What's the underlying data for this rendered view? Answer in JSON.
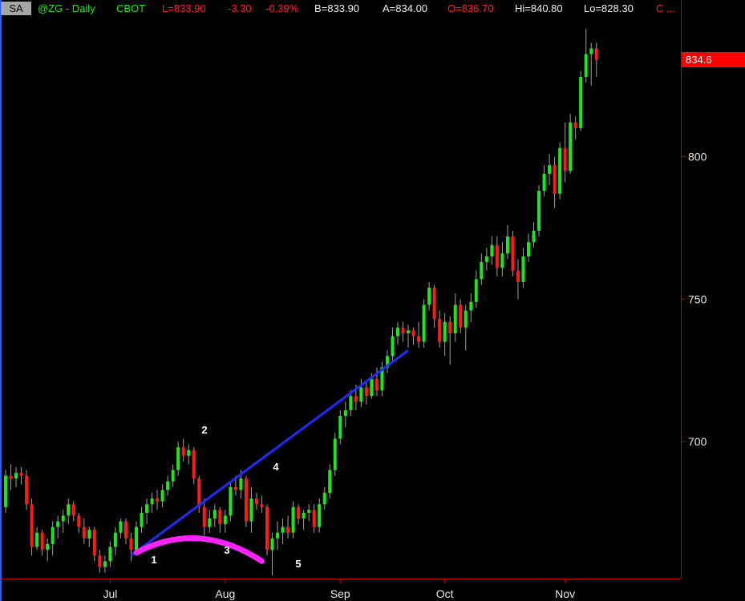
{
  "header": {
    "symbol_box": "SA",
    "symbol": "@ZG - Daily",
    "exchange": "CBOT",
    "last": "L=833.90",
    "change": "-3.30",
    "change_pct": "-0.39%",
    "bid": "B=833.90",
    "ask": "A=834.00",
    "open": "O=836.70",
    "high": "Hi=840.80",
    "low": "Lo=828.30",
    "close": "C ..."
  },
  "colors": {
    "background": "#000000",
    "up_candle": "#19e819",
    "down_candle": "#ff1a1a",
    "wick": "#a0a0a0",
    "trendline": "#1f2bff",
    "arc": "#ff22ff",
    "axis": "#c00000",
    "last_price_label": "#ff0000"
  },
  "chart_data": {
    "type": "candlestick",
    "title": "@ZG - Daily",
    "ylim": [
      653,
      840
    ],
    "y_ticks": [
      700,
      750,
      800
    ],
    "x_tick_labels": [
      "Jul",
      "Aug",
      "Sep",
      "Oct",
      "Nov"
    ],
    "last_price_label": "834.6",
    "last_price": 834.6,
    "annotations": [
      "1",
      "2",
      "3",
      "4",
      "5"
    ],
    "trendline": {
      "from": {
        "date": "Jul 8",
        "price": 660
      },
      "to": {
        "date": "Sep 20",
        "price": 732
      }
    },
    "arc": {
      "start": {
        "date": "Jul 9",
        "price": 661
      },
      "peak": {
        "date": "Jul 25",
        "price": 666
      },
      "end": {
        "date": "Aug 12",
        "price": 658
      }
    },
    "candles": [
      {
        "date": "Jun 3",
        "o": 677,
        "h": 690,
        "l": 675,
        "c": 688
      },
      {
        "date": "Jun 4",
        "o": 688,
        "h": 692,
        "l": 683,
        "c": 687
      },
      {
        "date": "Jun 5",
        "o": 687,
        "h": 691,
        "l": 684,
        "c": 689
      },
      {
        "date": "Jun 6",
        "o": 689,
        "h": 691,
        "l": 685,
        "c": 688
      },
      {
        "date": "Jun 7",
        "o": 688,
        "h": 690,
        "l": 676,
        "c": 678
      },
      {
        "date": "Jun 10",
        "o": 678,
        "h": 680,
        "l": 660,
        "c": 663
      },
      {
        "date": "Jun 11",
        "o": 663,
        "h": 670,
        "l": 662,
        "c": 668
      },
      {
        "date": "Jun 12",
        "o": 668,
        "h": 669,
        "l": 660,
        "c": 662
      },
      {
        "date": "Jun 13",
        "o": 662,
        "h": 666,
        "l": 658,
        "c": 664
      },
      {
        "date": "Jun 14",
        "o": 664,
        "h": 672,
        "l": 660,
        "c": 670
      },
      {
        "date": "Jun 17",
        "o": 670,
        "h": 674,
        "l": 666,
        "c": 672
      },
      {
        "date": "Jun 18",
        "o": 672,
        "h": 676,
        "l": 668,
        "c": 674
      },
      {
        "date": "Jun 19",
        "o": 674,
        "h": 680,
        "l": 671,
        "c": 678
      },
      {
        "date": "Jun 20",
        "o": 678,
        "h": 679,
        "l": 672,
        "c": 674
      },
      {
        "date": "Jun 21",
        "o": 674,
        "h": 675,
        "l": 668,
        "c": 670
      },
      {
        "date": "Jun 24",
        "o": 670,
        "h": 673,
        "l": 664,
        "c": 666
      },
      {
        "date": "Jun 25",
        "o": 666,
        "h": 670,
        "l": 663,
        "c": 669
      },
      {
        "date": "Jun 26",
        "o": 669,
        "h": 670,
        "l": 658,
        "c": 660
      },
      {
        "date": "Jun 27",
        "o": 660,
        "h": 662,
        "l": 654,
        "c": 656
      },
      {
        "date": "Jun 28",
        "o": 656,
        "h": 660,
        "l": 654,
        "c": 658
      },
      {
        "date": "Jul 1",
        "o": 658,
        "h": 665,
        "l": 656,
        "c": 663
      },
      {
        "date": "Jul 2",
        "o": 663,
        "h": 670,
        "l": 660,
        "c": 668
      },
      {
        "date": "Jul 3",
        "o": 668,
        "h": 673,
        "l": 666,
        "c": 672
      },
      {
        "date": "Jul 5",
        "o": 672,
        "h": 673,
        "l": 664,
        "c": 666
      },
      {
        "date": "Jul 8",
        "o": 666,
        "h": 668,
        "l": 658,
        "c": 662
      },
      {
        "date": "Jul 9",
        "o": 662,
        "h": 672,
        "l": 660,
        "c": 670
      },
      {
        "date": "Jul 10",
        "o": 670,
        "h": 677,
        "l": 668,
        "c": 675
      },
      {
        "date": "Jul 11",
        "o": 675,
        "h": 680,
        "l": 671,
        "c": 678
      },
      {
        "date": "Jul 12",
        "o": 678,
        "h": 682,
        "l": 675,
        "c": 680
      },
      {
        "date": "Jul 15",
        "o": 680,
        "h": 683,
        "l": 676,
        "c": 679
      },
      {
        "date": "Jul 16",
        "o": 679,
        "h": 685,
        "l": 677,
        "c": 683
      },
      {
        "date": "Jul 17",
        "o": 683,
        "h": 688,
        "l": 681,
        "c": 686
      },
      {
        "date": "Jul 18",
        "o": 686,
        "h": 692,
        "l": 684,
        "c": 690
      },
      {
        "date": "Jul 19",
        "o": 690,
        "h": 700,
        "l": 688,
        "c": 698
      },
      {
        "date": "Jul 22",
        "o": 698,
        "h": 701,
        "l": 693,
        "c": 695
      },
      {
        "date": "Jul 23",
        "o": 695,
        "h": 699,
        "l": 692,
        "c": 697
      },
      {
        "date": "Jul 24",
        "o": 697,
        "h": 698,
        "l": 685,
        "c": 687
      },
      {
        "date": "Jul 25",
        "o": 687,
        "h": 688,
        "l": 675,
        "c": 677
      },
      {
        "date": "Jul 26",
        "o": 677,
        "h": 680,
        "l": 667,
        "c": 670
      },
      {
        "date": "Jul 29",
        "o": 670,
        "h": 676,
        "l": 668,
        "c": 673
      },
      {
        "date": "Jul 30",
        "o": 673,
        "h": 678,
        "l": 670,
        "c": 676
      },
      {
        "date": "Jul 31",
        "o": 676,
        "h": 677,
        "l": 668,
        "c": 671
      },
      {
        "date": "Aug 1",
        "o": 671,
        "h": 676,
        "l": 668,
        "c": 674
      },
      {
        "date": "Aug 2",
        "o": 674,
        "h": 686,
        "l": 672,
        "c": 684
      },
      {
        "date": "Aug 5",
        "o": 684,
        "h": 688,
        "l": 681,
        "c": 683
      },
      {
        "date": "Aug 6",
        "o": 683,
        "h": 690,
        "l": 680,
        "c": 687
      },
      {
        "date": "Aug 7",
        "o": 687,
        "h": 688,
        "l": 670,
        "c": 672
      },
      {
        "date": "Aug 8",
        "o": 672,
        "h": 684,
        "l": 668,
        "c": 680
      },
      {
        "date": "Aug 9",
        "o": 680,
        "h": 682,
        "l": 676,
        "c": 678
      },
      {
        "date": "Aug 12",
        "o": 678,
        "h": 681,
        "l": 675,
        "c": 677
      },
      {
        "date": "Aug 13",
        "o": 677,
        "h": 678,
        "l": 660,
        "c": 662
      },
      {
        "date": "Aug 14",
        "o": 662,
        "h": 668,
        "l": 653,
        "c": 666
      },
      {
        "date": "Aug 15",
        "o": 666,
        "h": 672,
        "l": 662,
        "c": 668
      },
      {
        "date": "Aug 16",
        "o": 668,
        "h": 673,
        "l": 664,
        "c": 670
      },
      {
        "date": "Aug 19",
        "o": 670,
        "h": 674,
        "l": 666,
        "c": 668
      },
      {
        "date": "Aug 20",
        "o": 668,
        "h": 679,
        "l": 666,
        "c": 677
      },
      {
        "date": "Aug 21",
        "o": 677,
        "h": 678,
        "l": 671,
        "c": 673
      },
      {
        "date": "Aug 22",
        "o": 673,
        "h": 676,
        "l": 669,
        "c": 675
      },
      {
        "date": "Aug 23",
        "o": 675,
        "h": 678,
        "l": 672,
        "c": 676
      },
      {
        "date": "Aug 26",
        "o": 676,
        "h": 678,
        "l": 668,
        "c": 670
      },
      {
        "date": "Aug 27",
        "o": 670,
        "h": 680,
        "l": 668,
        "c": 678
      },
      {
        "date": "Aug 28",
        "o": 678,
        "h": 684,
        "l": 676,
        "c": 682
      },
      {
        "date": "Aug 29",
        "o": 682,
        "h": 692,
        "l": 680,
        "c": 690
      },
      {
        "date": "Aug 30",
        "o": 690,
        "h": 703,
        "l": 688,
        "c": 701
      },
      {
        "date": "Sep 3",
        "o": 701,
        "h": 711,
        "l": 699,
        "c": 709
      },
      {
        "date": "Sep 4",
        "o": 709,
        "h": 714,
        "l": 705,
        "c": 711
      },
      {
        "date": "Sep 5",
        "o": 711,
        "h": 718,
        "l": 709,
        "c": 716
      },
      {
        "date": "Sep 6",
        "o": 716,
        "h": 720,
        "l": 711,
        "c": 714
      },
      {
        "date": "Sep 9",
        "o": 714,
        "h": 722,
        "l": 712,
        "c": 719
      },
      {
        "date": "Sep 10",
        "o": 719,
        "h": 721,
        "l": 713,
        "c": 716
      },
      {
        "date": "Sep 11",
        "o": 716,
        "h": 724,
        "l": 715,
        "c": 722
      },
      {
        "date": "Sep 12",
        "o": 722,
        "h": 726,
        "l": 716,
        "c": 718
      },
      {
        "date": "Sep 13",
        "o": 718,
        "h": 728,
        "l": 716,
        "c": 726
      },
      {
        "date": "Sep 16",
        "o": 726,
        "h": 732,
        "l": 724,
        "c": 730
      },
      {
        "date": "Sep 17",
        "o": 730,
        "h": 740,
        "l": 728,
        "c": 737
      },
      {
        "date": "Sep 18",
        "o": 737,
        "h": 742,
        "l": 734,
        "c": 740
      },
      {
        "date": "Sep 19",
        "o": 740,
        "h": 742,
        "l": 735,
        "c": 738
      },
      {
        "date": "Sep 20",
        "o": 738,
        "h": 741,
        "l": 733,
        "c": 739
      },
      {
        "date": "Sep 23",
        "o": 739,
        "h": 740,
        "l": 734,
        "c": 737
      },
      {
        "date": "Sep 24",
        "o": 737,
        "h": 742,
        "l": 733,
        "c": 735
      },
      {
        "date": "Sep 25",
        "o": 735,
        "h": 750,
        "l": 733,
        "c": 748
      },
      {
        "date": "Sep 26",
        "o": 748,
        "h": 756,
        "l": 746,
        "c": 754
      },
      {
        "date": "Sep 27",
        "o": 754,
        "h": 755,
        "l": 740,
        "c": 743
      },
      {
        "date": "Sep 30",
        "o": 743,
        "h": 746,
        "l": 733,
        "c": 735
      },
      {
        "date": "Oct 1",
        "o": 735,
        "h": 745,
        "l": 730,
        "c": 742
      },
      {
        "date": "Oct 2",
        "o": 742,
        "h": 744,
        "l": 727,
        "c": 738
      },
      {
        "date": "Oct 3",
        "o": 738,
        "h": 752,
        "l": 735,
        "c": 748
      },
      {
        "date": "Oct 4",
        "o": 748,
        "h": 750,
        "l": 738,
        "c": 740
      },
      {
        "date": "Oct 7",
        "o": 740,
        "h": 748,
        "l": 732,
        "c": 746
      },
      {
        "date": "Oct 8",
        "o": 746,
        "h": 752,
        "l": 742,
        "c": 749
      },
      {
        "date": "Oct 9",
        "o": 749,
        "h": 760,
        "l": 747,
        "c": 757
      },
      {
        "date": "Oct 10",
        "o": 757,
        "h": 766,
        "l": 755,
        "c": 763
      },
      {
        "date": "Oct 11",
        "o": 763,
        "h": 768,
        "l": 760,
        "c": 765
      },
      {
        "date": "Oct 14",
        "o": 765,
        "h": 772,
        "l": 762,
        "c": 769
      },
      {
        "date": "Oct 15",
        "o": 769,
        "h": 772,
        "l": 758,
        "c": 761
      },
      {
        "date": "Oct 16",
        "o": 761,
        "h": 770,
        "l": 758,
        "c": 766
      },
      {
        "date": "Oct 17",
        "o": 766,
        "h": 776,
        "l": 764,
        "c": 772
      },
      {
        "date": "Oct 18",
        "o": 772,
        "h": 774,
        "l": 758,
        "c": 760
      },
      {
        "date": "Oct 21",
        "o": 760,
        "h": 764,
        "l": 750,
        "c": 756
      },
      {
        "date": "Oct 22",
        "o": 756,
        "h": 768,
        "l": 754,
        "c": 765
      },
      {
        "date": "Oct 23",
        "o": 765,
        "h": 773,
        "l": 763,
        "c": 770
      },
      {
        "date": "Oct 24",
        "o": 770,
        "h": 777,
        "l": 768,
        "c": 774
      },
      {
        "date": "Oct 25",
        "o": 774,
        "h": 790,
        "l": 772,
        "c": 788
      },
      {
        "date": "Oct 28",
        "o": 788,
        "h": 797,
        "l": 786,
        "c": 794
      },
      {
        "date": "Oct 29",
        "o": 794,
        "h": 801,
        "l": 790,
        "c": 797
      },
      {
        "date": "Oct 30",
        "o": 797,
        "h": 800,
        "l": 782,
        "c": 787
      },
      {
        "date": "Oct 31",
        "o": 787,
        "h": 805,
        "l": 785,
        "c": 803
      },
      {
        "date": "Nov 1",
        "o": 803,
        "h": 812,
        "l": 791,
        "c": 795
      },
      {
        "date": "Nov 4",
        "o": 795,
        "h": 815,
        "l": 794,
        "c": 812
      },
      {
        "date": "Nov 5",
        "o": 812,
        "h": 814,
        "l": 806,
        "c": 810
      },
      {
        "date": "Nov 6",
        "o": 810,
        "h": 830,
        "l": 809,
        "c": 828
      },
      {
        "date": "Nov 7",
        "o": 828,
        "h": 845,
        "l": 826,
        "c": 836
      },
      {
        "date": "Nov 8",
        "o": 836,
        "h": 840,
        "l": 825,
        "c": 838
      },
      {
        "date": "Nov 11",
        "o": 838,
        "h": 840,
        "l": 828,
        "c": 834
      }
    ]
  }
}
